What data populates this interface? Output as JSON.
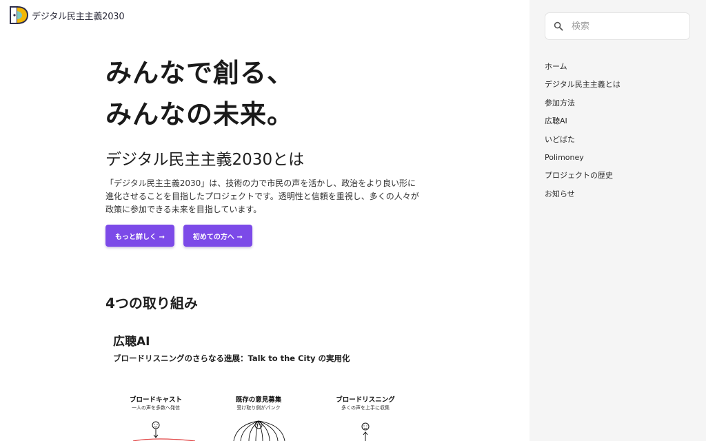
{
  "header": {
    "logo_text": "デジタル民主主義2030",
    "logo_colors": {
      "left": "#6d5bd0",
      "right": "#f2b705",
      "mid": "#2fb0b0"
    }
  },
  "search": {
    "placeholder": "検索",
    "icon": "search-icon"
  },
  "sidebar": {
    "items": [
      {
        "label": "ホーム"
      },
      {
        "label": "デジタル民主主義とは"
      },
      {
        "label": "参加方法"
      },
      {
        "label": "広聴AI"
      },
      {
        "label": "いどばた"
      },
      {
        "label": "Polimoney"
      },
      {
        "label": "プロジェクトの歴史"
      },
      {
        "label": "お知らせ"
      }
    ]
  },
  "hero": {
    "line1": "みんなで創る、",
    "line2": "みんなの未来。"
  },
  "about": {
    "heading": "デジタル民主主義2030とは",
    "body": "「デジタル民主主義2030」は、技術の力で市民の声を活かし、政治をより良い形に進化させることを目指したプロジェクトです。透明性と信頼を重視し、多くの人々が政策に参加できる未来を目指しています。"
  },
  "buttons": {
    "more": "もっと詳しく →",
    "first": "初めての方へ →"
  },
  "accent_color": "#7c4ae8",
  "initiatives": {
    "heading": "4つの取り組み",
    "koucho_heading": "広聴AI",
    "koucho_sub": "ブロードリスニングのさらなる進展：Talk to the City の実用化"
  },
  "illustration": {
    "columns": [
      {
        "title": "ブロードキャスト",
        "sub": "一人の声を多数へ発信"
      },
      {
        "title": "既存の意見募集",
        "sub": "受け取り側がパンク"
      },
      {
        "title": "ブロードリスニング",
        "sub": "多くの声を上手に収集"
      }
    ]
  }
}
